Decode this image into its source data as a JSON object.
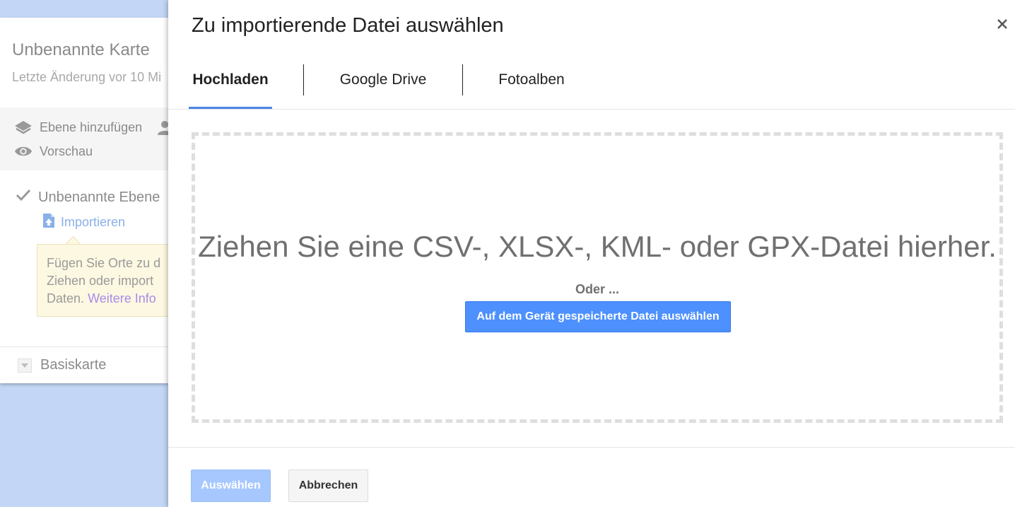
{
  "map_app": {
    "title": "Unbenannte Karte",
    "last_modified": "Letzte Änderung vor 10 Mi",
    "add_layer_label": "Ebene hinzufügen",
    "preview_label": "Vorschau",
    "layer_name": "Unbenannte Ebene",
    "import_label": "Importieren",
    "hint_line1": "Fügen Sie Orte zu d",
    "hint_line2": "Ziehen oder import",
    "hint_line3_prefix": "Daten.",
    "hint_more_link": "Weitere Info",
    "basemap_label": "Basiskarte",
    "icons": [
      "layers-icon",
      "person-icon",
      "eye-icon",
      "checkmark-icon",
      "file-import-icon",
      "dropdown-arrow-icon"
    ]
  },
  "dialog": {
    "title": "Zu importierende Datei auswählen",
    "close_icon": "close-icon",
    "tabs": [
      {
        "label": "Hochladen",
        "active": true
      },
      {
        "label": "Google Drive",
        "active": false
      },
      {
        "label": "Fotoalben",
        "active": false
      }
    ],
    "drop_text": "Ziehen Sie eine CSV-, XLSX-, KML- oder GPX-Datei hierher.",
    "or_text": "Oder ...",
    "choose_file_label": "Auf dem Gerät gespeicherte Datei auswählen",
    "select_label": "Auswählen",
    "select_enabled": false,
    "cancel_label": "Abbrechen"
  },
  "colors": {
    "accent_blue": "#4d90fe",
    "tab_underline": "#4a86e8",
    "disabled_blue": "#a6c8ff",
    "map_background": "#c3d6f5",
    "hint_background": "#fdf8e2",
    "link_purple": "#a98ce8"
  }
}
